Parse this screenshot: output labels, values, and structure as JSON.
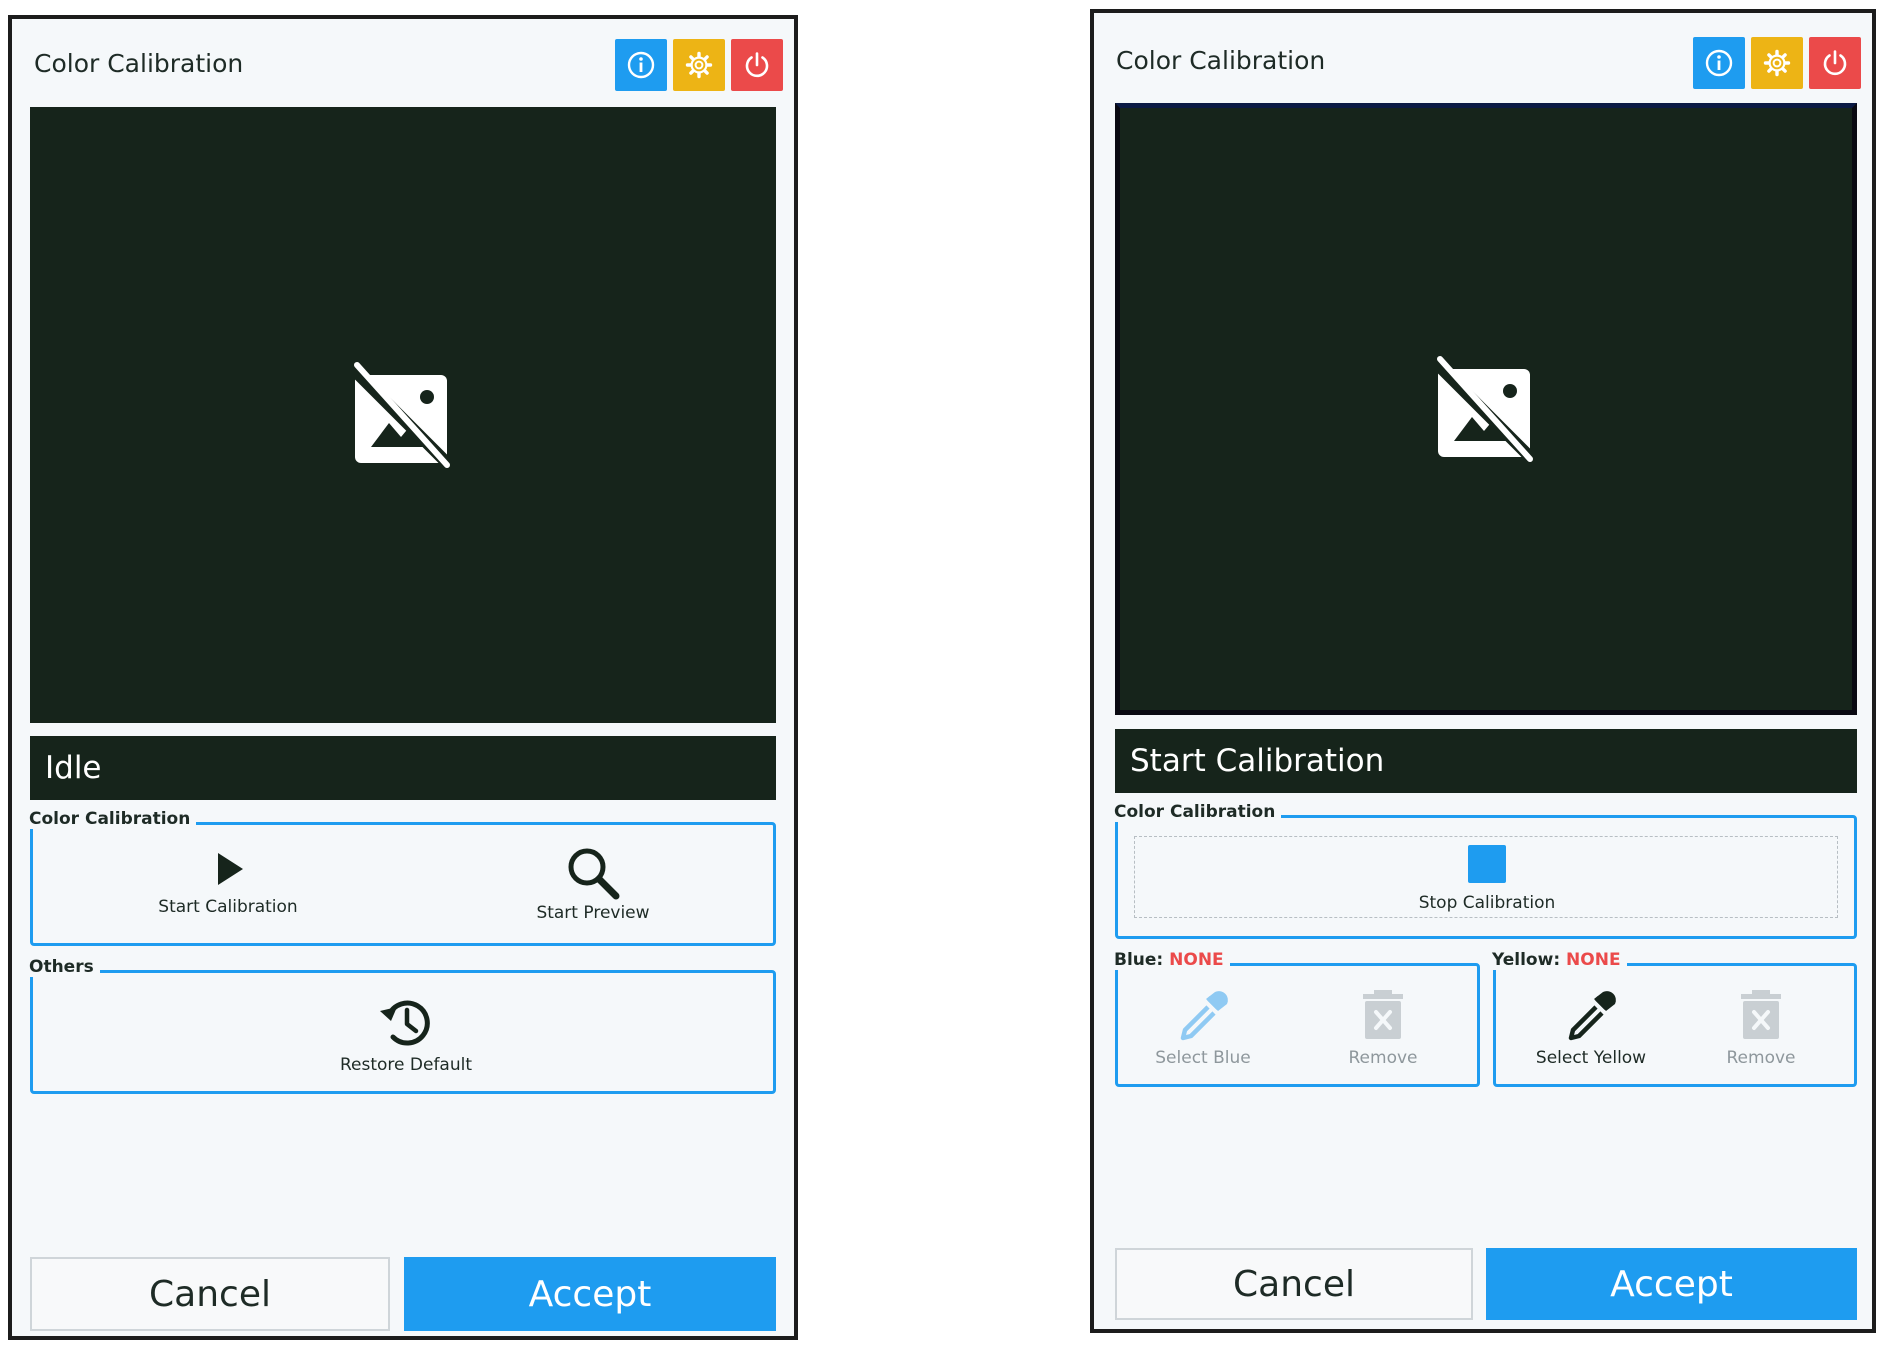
{
  "colors": {
    "accent": "#1e9cf0",
    "warning": "#edb415",
    "danger": "#eb4a4a",
    "video_bg": "#16241b",
    "panel_bg": "#f5f8fa"
  },
  "left": {
    "title": "Color Calibration",
    "header_icons": [
      "info-icon",
      "gear-icon",
      "power-icon"
    ],
    "video_icon": "image-off-icon",
    "status": "Idle",
    "calibration_group": {
      "legend": "Color Calibration",
      "buttons": [
        {
          "label": "Start Calibration",
          "icon": "play-icon"
        },
        {
          "label": "Start Preview",
          "icon": "search-icon"
        }
      ]
    },
    "others_group": {
      "legend": "Others",
      "buttons": [
        {
          "label": "Restore Default",
          "icon": "history-icon"
        }
      ]
    },
    "footer": {
      "cancel": "Cancel",
      "accept": "Accept"
    }
  },
  "right": {
    "title": "Color Calibration",
    "header_icons": [
      "info-icon",
      "gear-icon",
      "power-icon"
    ],
    "video_icon": "image-off-icon",
    "status": "Start Calibration",
    "calibration_group": {
      "legend": "Color Calibration",
      "buttons": [
        {
          "label": "Stop Calibration",
          "icon": "stop-icon"
        }
      ]
    },
    "blue_group": {
      "legend_prefix": "Blue:",
      "legend_value": "NONE",
      "buttons": [
        {
          "label": "Select Blue",
          "icon": "eyedropper-icon",
          "enabled": false
        },
        {
          "label": "Remove",
          "icon": "delete-icon",
          "enabled": false
        }
      ]
    },
    "yellow_group": {
      "legend_prefix": "Yellow:",
      "legend_value": "NONE",
      "buttons": [
        {
          "label": "Select Yellow",
          "icon": "eyedropper-icon",
          "enabled": true
        },
        {
          "label": "Remove",
          "icon": "delete-icon",
          "enabled": false
        }
      ]
    },
    "footer": {
      "cancel": "Cancel",
      "accept": "Accept"
    }
  }
}
